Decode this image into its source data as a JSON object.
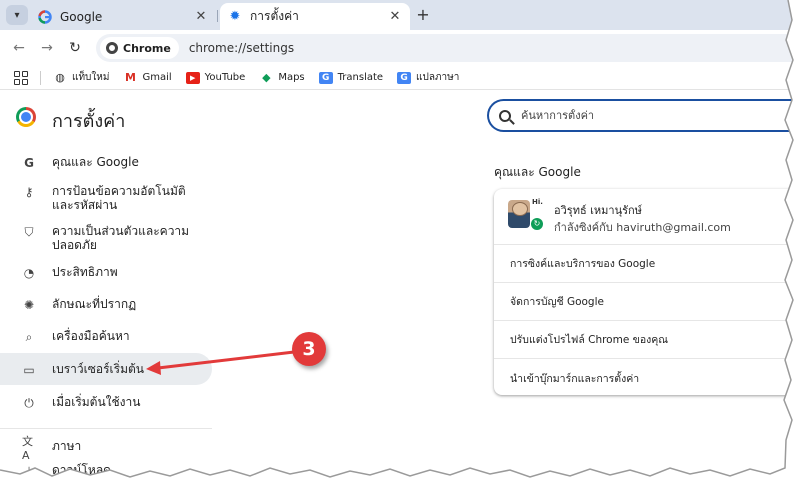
{
  "tabs": [
    {
      "title": "Google",
      "favicon": "google-g-icon"
    },
    {
      "title": "การตั้งค่า",
      "favicon": "gear-icon"
    }
  ],
  "toolbar": {
    "chip_label": "Chrome",
    "url": "chrome://settings"
  },
  "bookmarks": [
    {
      "label": "แท็บใหม่",
      "icon": "globe-icon"
    },
    {
      "label": "Gmail",
      "icon": "gmail-icon"
    },
    {
      "label": "YouTube",
      "icon": "youtube-icon"
    },
    {
      "label": "Maps",
      "icon": "maps-icon"
    },
    {
      "label": "Translate",
      "icon": "translate-icon"
    },
    {
      "label": "แปลภาษา",
      "icon": "translate-icon"
    }
  ],
  "settings": {
    "title": "การตั้งค่า",
    "search_placeholder": "ค้นหาการตั้งค่า",
    "nav": [
      {
        "label": "คุณและ Google",
        "icon": "google-g-icon"
      },
      {
        "label": "การป้อนข้อความอัตโนมัติและรหัสผ่าน",
        "icon": "key-icon"
      },
      {
        "label": "ความเป็นส่วนตัวและความปลอดภัย",
        "icon": "shield-icon"
      },
      {
        "label": "ประสิทธิภาพ",
        "icon": "speedometer-icon"
      },
      {
        "label": "ลักษณะที่ปรากฏ",
        "icon": "palette-icon"
      },
      {
        "label": "เครื่องมือค้นหา",
        "icon": "search-icon"
      },
      {
        "label": "เบราว์เซอร์เริ่มต้น",
        "icon": "browser-window-icon"
      },
      {
        "label": "เมื่อเริ่มต้นใช้งาน",
        "icon": "power-icon"
      },
      {
        "label": "ภาษา",
        "icon": "language-icon"
      },
      {
        "label": "ดาวน์โหลด",
        "icon": "download-icon"
      }
    ],
    "section_title": "คุณและ Google",
    "profile": {
      "tag": "Hi.",
      "name": "อวิรุทธ์ เหมานุรักษ์",
      "email": "กำลังซิงค์กับ haviruth@gmail.com"
    },
    "rows": [
      "การซิงค์และบริการของ Google",
      "จัดการบัญชี Google",
      "ปรับแต่งโปรไฟล์ Chrome ของคุณ",
      "นำเข้าบุ๊กมาร์กและการตั้งค่า"
    ]
  },
  "annotation": {
    "number": "3",
    "color": "#e23a3a"
  }
}
